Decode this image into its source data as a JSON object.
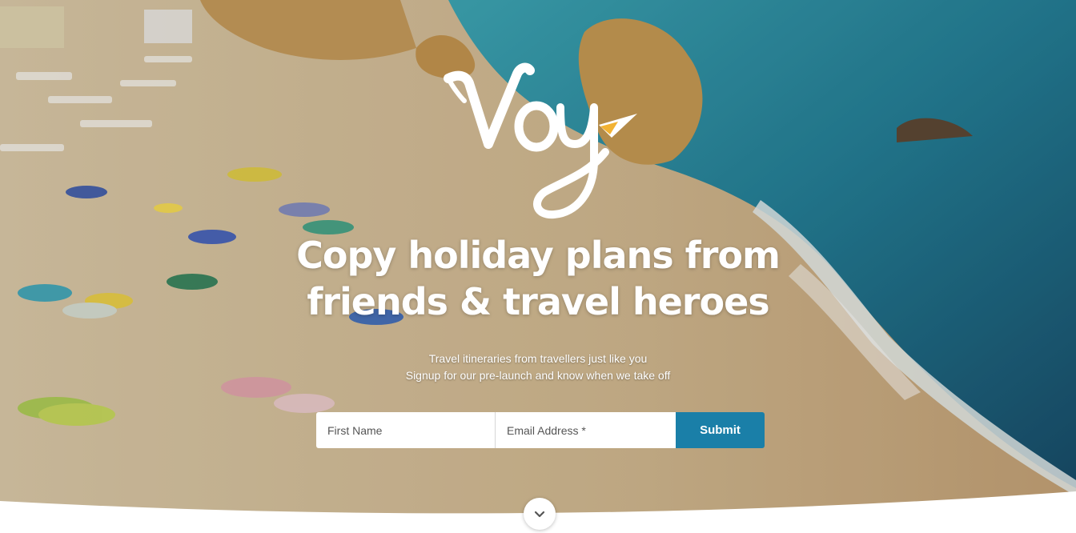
{
  "brand": {
    "logo_text": "Voy"
  },
  "hero": {
    "headline_line1": "Copy holiday plans from",
    "headline_line2": "friends & travel heroes",
    "sub_line1": "Travel itineraries from travellers just like you",
    "sub_line2": "Signup for our pre-launch and know when we take off"
  },
  "form": {
    "first_name_placeholder": "First Name",
    "email_placeholder": "Email Address *",
    "submit_label": "Submit"
  },
  "icons": {
    "scroll": "chevron-down-icon",
    "logo_arrow": "paper-plane-arrow-icon"
  },
  "colors": {
    "accent": "#1a7fa8",
    "logo_arrow": "#f2b233",
    "text": "#ffffff"
  }
}
